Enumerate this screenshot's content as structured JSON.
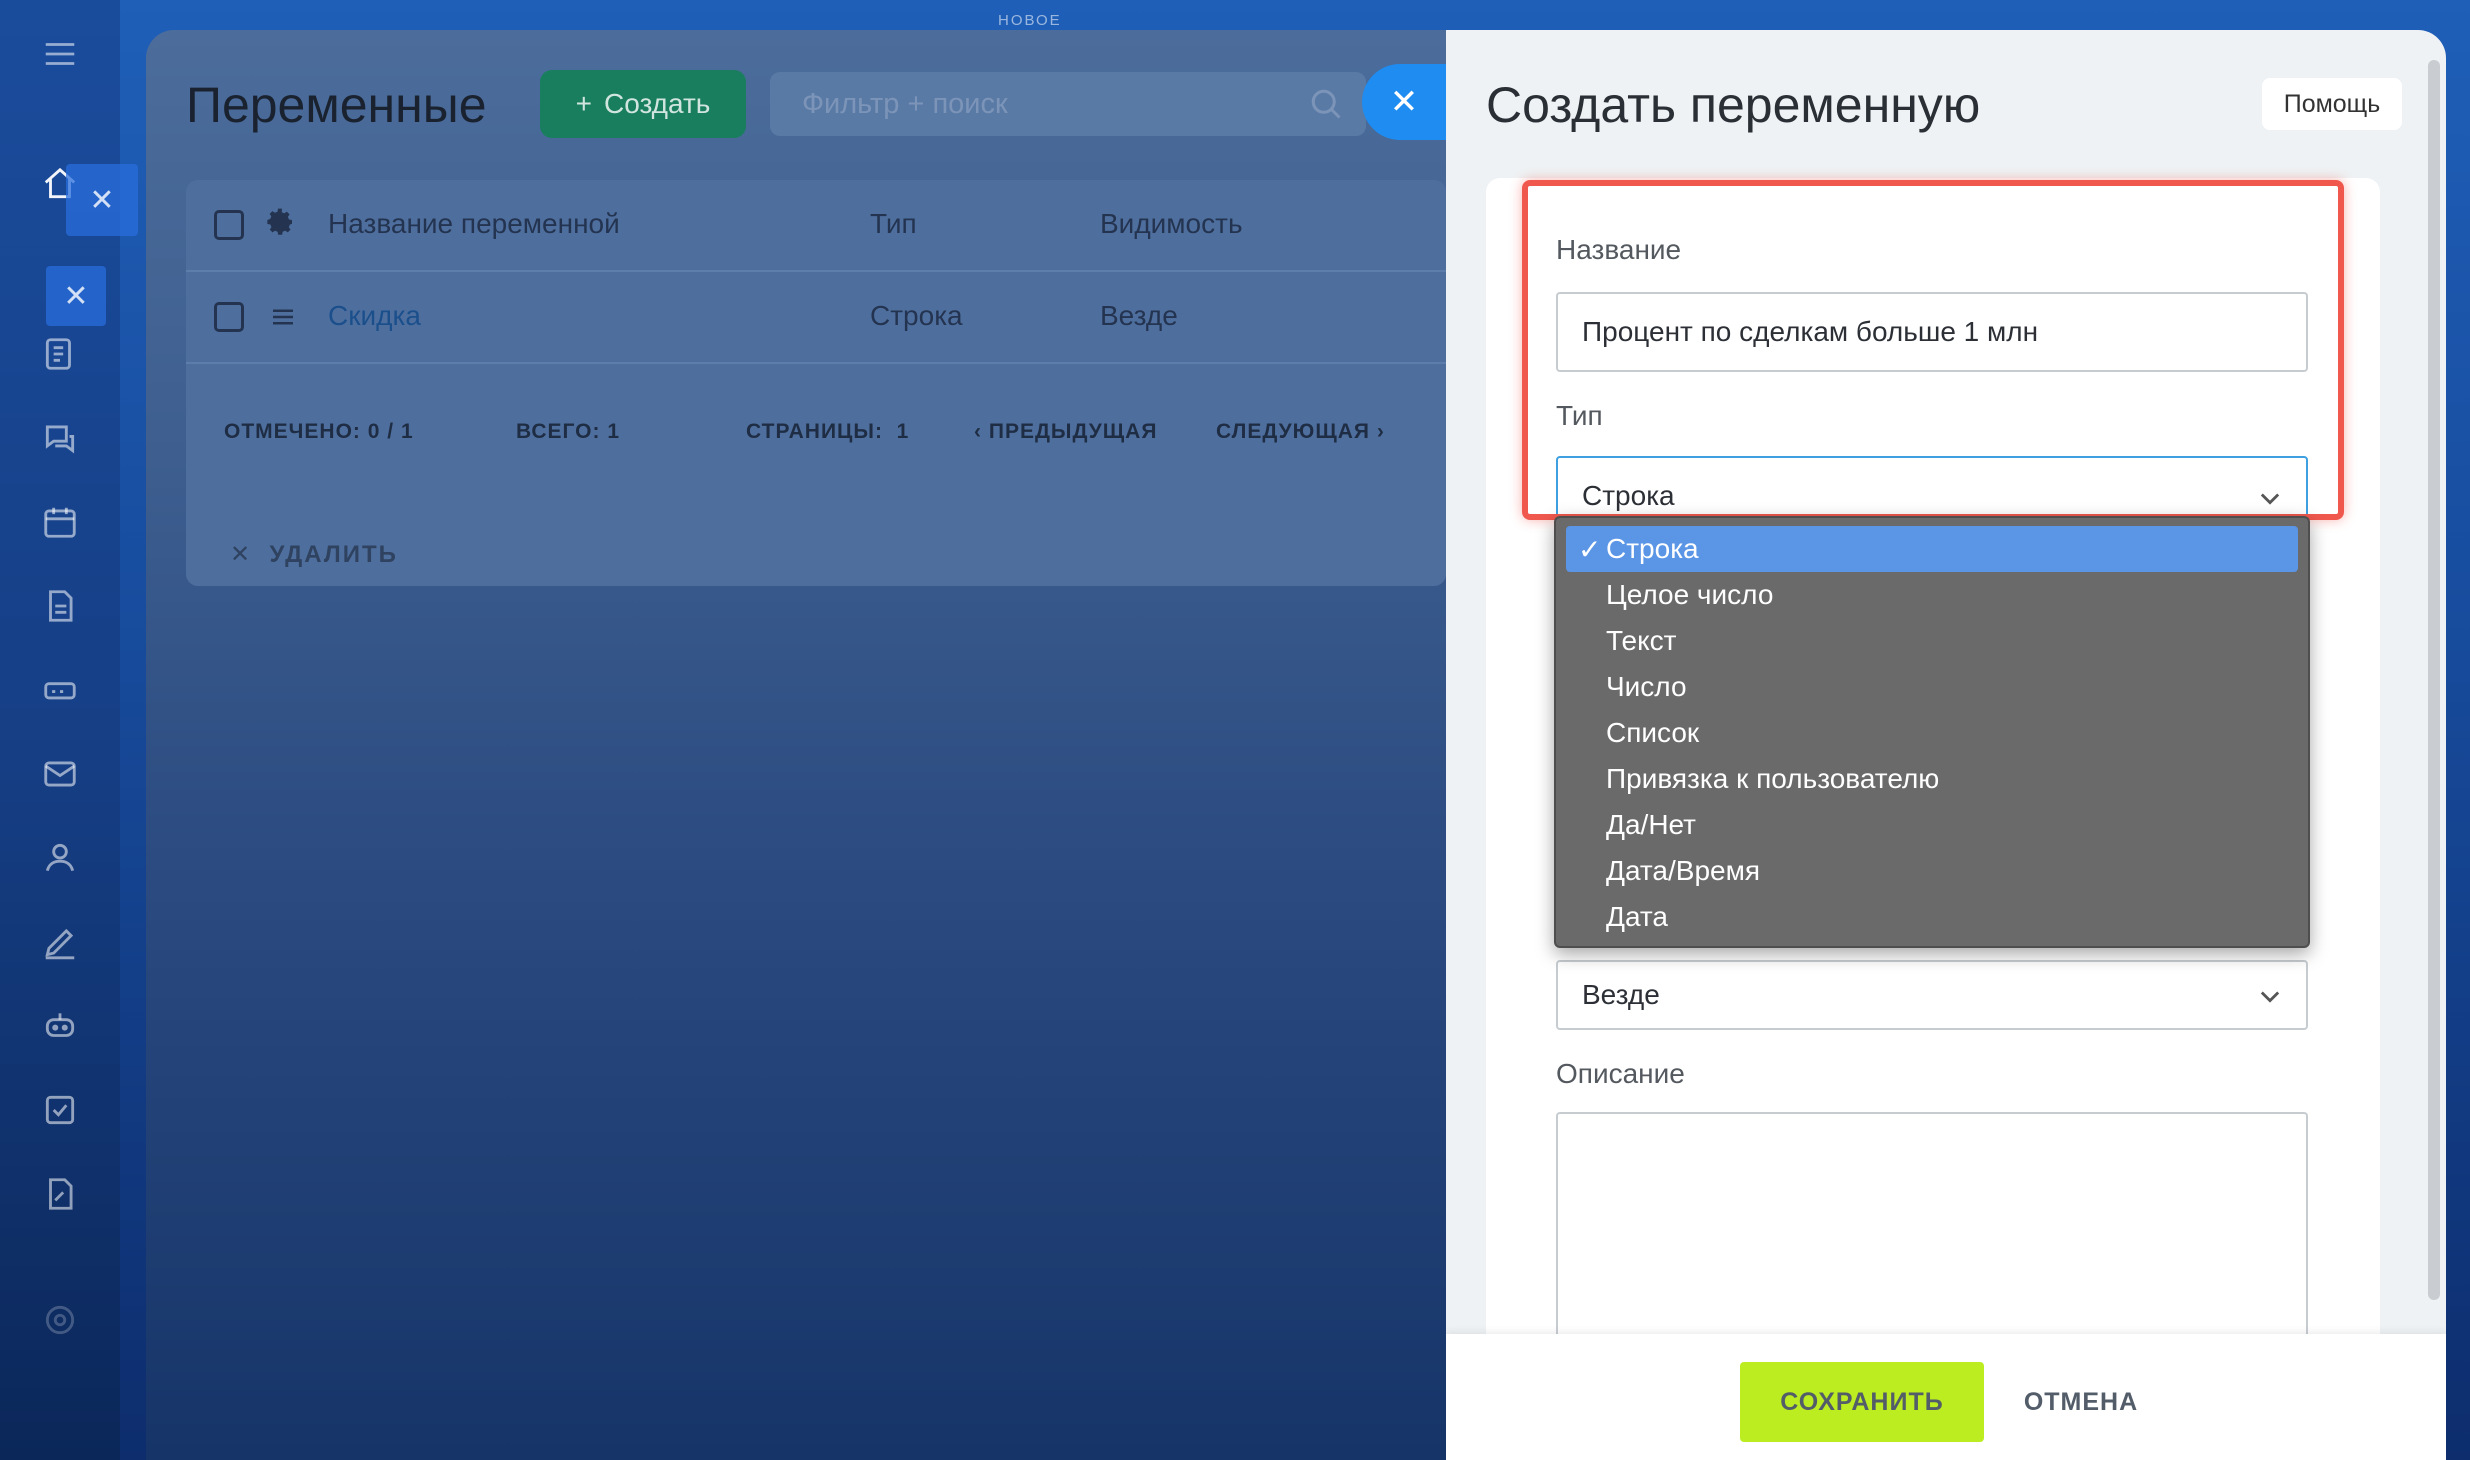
{
  "top_label": "НОВОЕ",
  "main": {
    "title": "Переменные",
    "create_label": "Создать",
    "filter_placeholder": "Фильтр + поиск",
    "table": {
      "headers": {
        "name": "Название переменной",
        "type": "Тип",
        "visibility": "Видимость"
      },
      "rows": [
        {
          "name": "Скидка",
          "type": "Строка",
          "visibility": "Везде"
        }
      ]
    },
    "pager": {
      "selected_label": "ОТМЕЧЕНО:",
      "selected_value": "0 / 1",
      "total_label": "ВСЕГО:",
      "total_value": "1",
      "pages_label": "СТРАНИЦЫ:",
      "pages_value": "1",
      "prev_label": "ПРЕДЫДУЩАЯ",
      "next_label": "СЛЕДУЮЩАЯ"
    },
    "delete_label": "УДАЛИТЬ"
  },
  "slider": {
    "title": "Создать переменную",
    "help_label": "Помощь",
    "fields": {
      "name_label": "Название",
      "name_value": "Процент по сделкам больше 1 млн",
      "type_label": "Тип",
      "type_value": "Строка",
      "visibility_value": "Везде",
      "description_label": "Описание"
    },
    "type_options": [
      "Строка",
      "Целое число",
      "Текст",
      "Число",
      "Список",
      "Привязка к пользователю",
      "Да/Нет",
      "Дата/Время",
      "Дата"
    ],
    "selected_option_mark": "✓",
    "save_label": "СОХРАНИТЬ",
    "cancel_label": "ОТМЕНА"
  },
  "colors": {
    "accent_save": "#bbed21",
    "create_button": "#197e5e",
    "highlight_frame": "#f0584e",
    "dropdown_selected": "#5a95e6"
  }
}
